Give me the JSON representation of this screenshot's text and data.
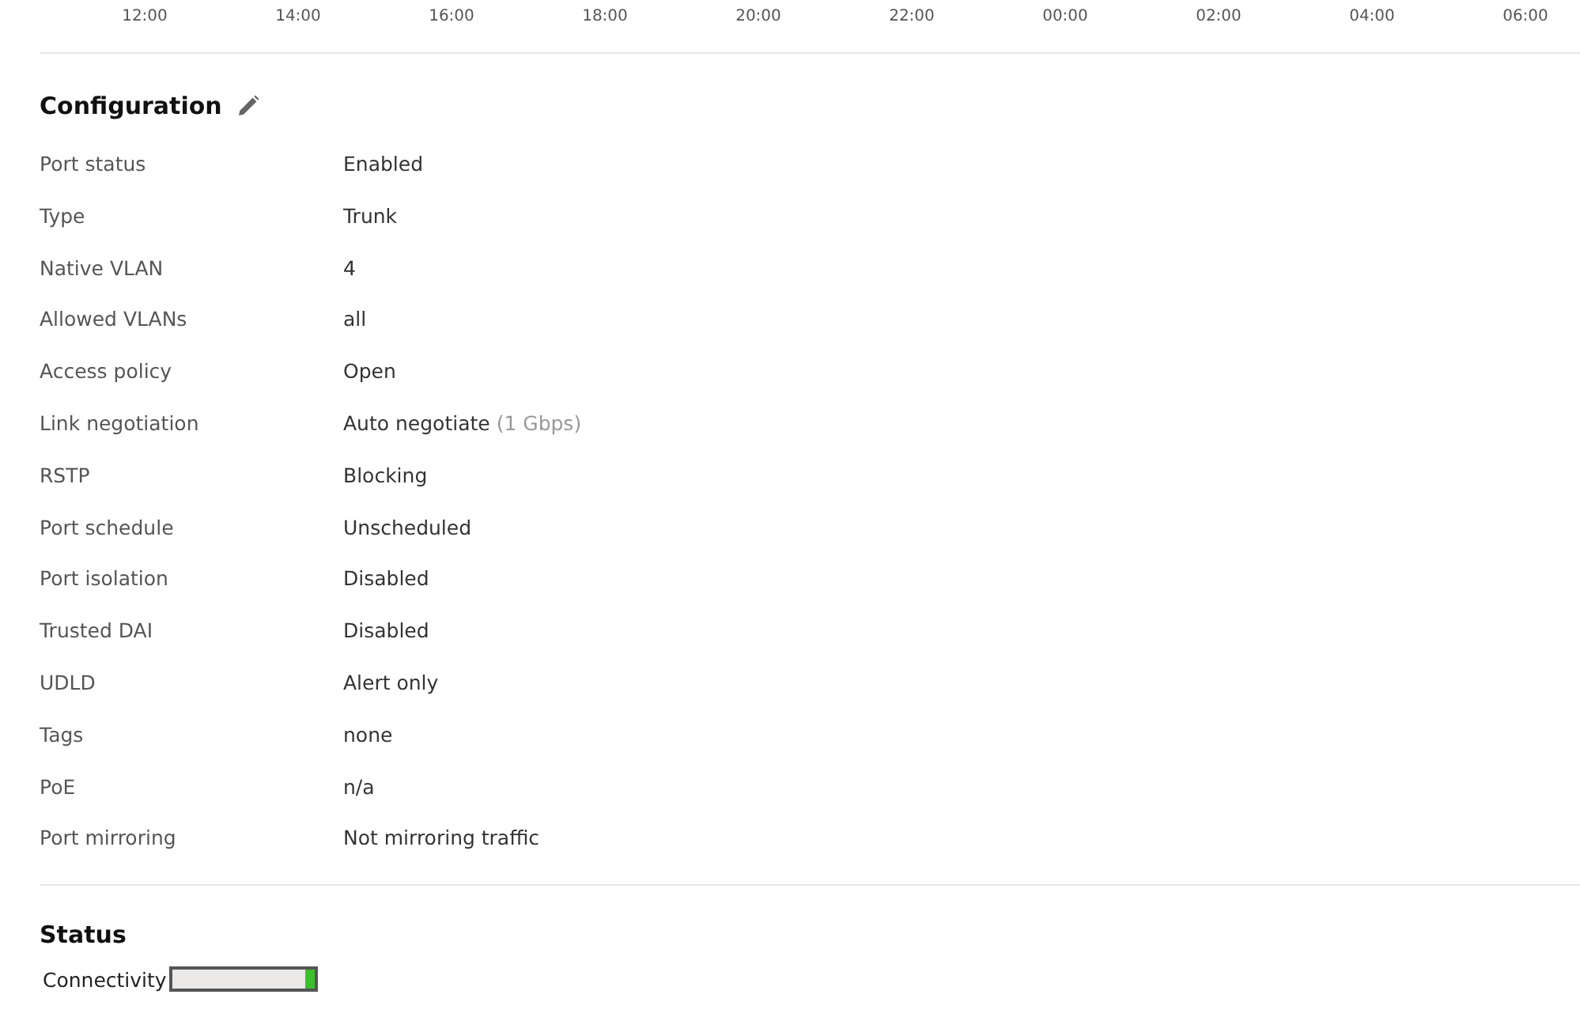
{
  "time_axis": {
    "labels": [
      "12:00",
      "14:00",
      "16:00",
      "18:00",
      "20:00",
      "22:00",
      "00:00",
      "02:00",
      "04:00",
      "06:00"
    ]
  },
  "configuration": {
    "title": "Configuration",
    "rows": [
      {
        "label": "Port status",
        "value": "Enabled"
      },
      {
        "label": "Type",
        "value": "Trunk"
      },
      {
        "label": "Native VLAN",
        "value": "4"
      },
      {
        "label": "Allowed VLANs",
        "value": "all"
      },
      {
        "label": "Access policy",
        "value": "Open"
      },
      {
        "label": "Link negotiation",
        "value": "Auto negotiate",
        "note": "(1 Gbps)"
      },
      {
        "label": "RSTP",
        "value": "Blocking"
      },
      {
        "label": "Port schedule",
        "value": "Unscheduled"
      },
      {
        "label": "Port isolation",
        "value": "Disabled"
      },
      {
        "label": "Trusted DAI",
        "value": "Disabled"
      },
      {
        "label": "UDLD",
        "value": "Alert only"
      },
      {
        "label": "Tags",
        "value": "none"
      },
      {
        "label": "PoE",
        "value": "n/a"
      },
      {
        "label": "Port mirroring",
        "value": "Not mirroring traffic"
      }
    ]
  },
  "status": {
    "title": "Status",
    "connectivity_label": "Connectivity"
  }
}
